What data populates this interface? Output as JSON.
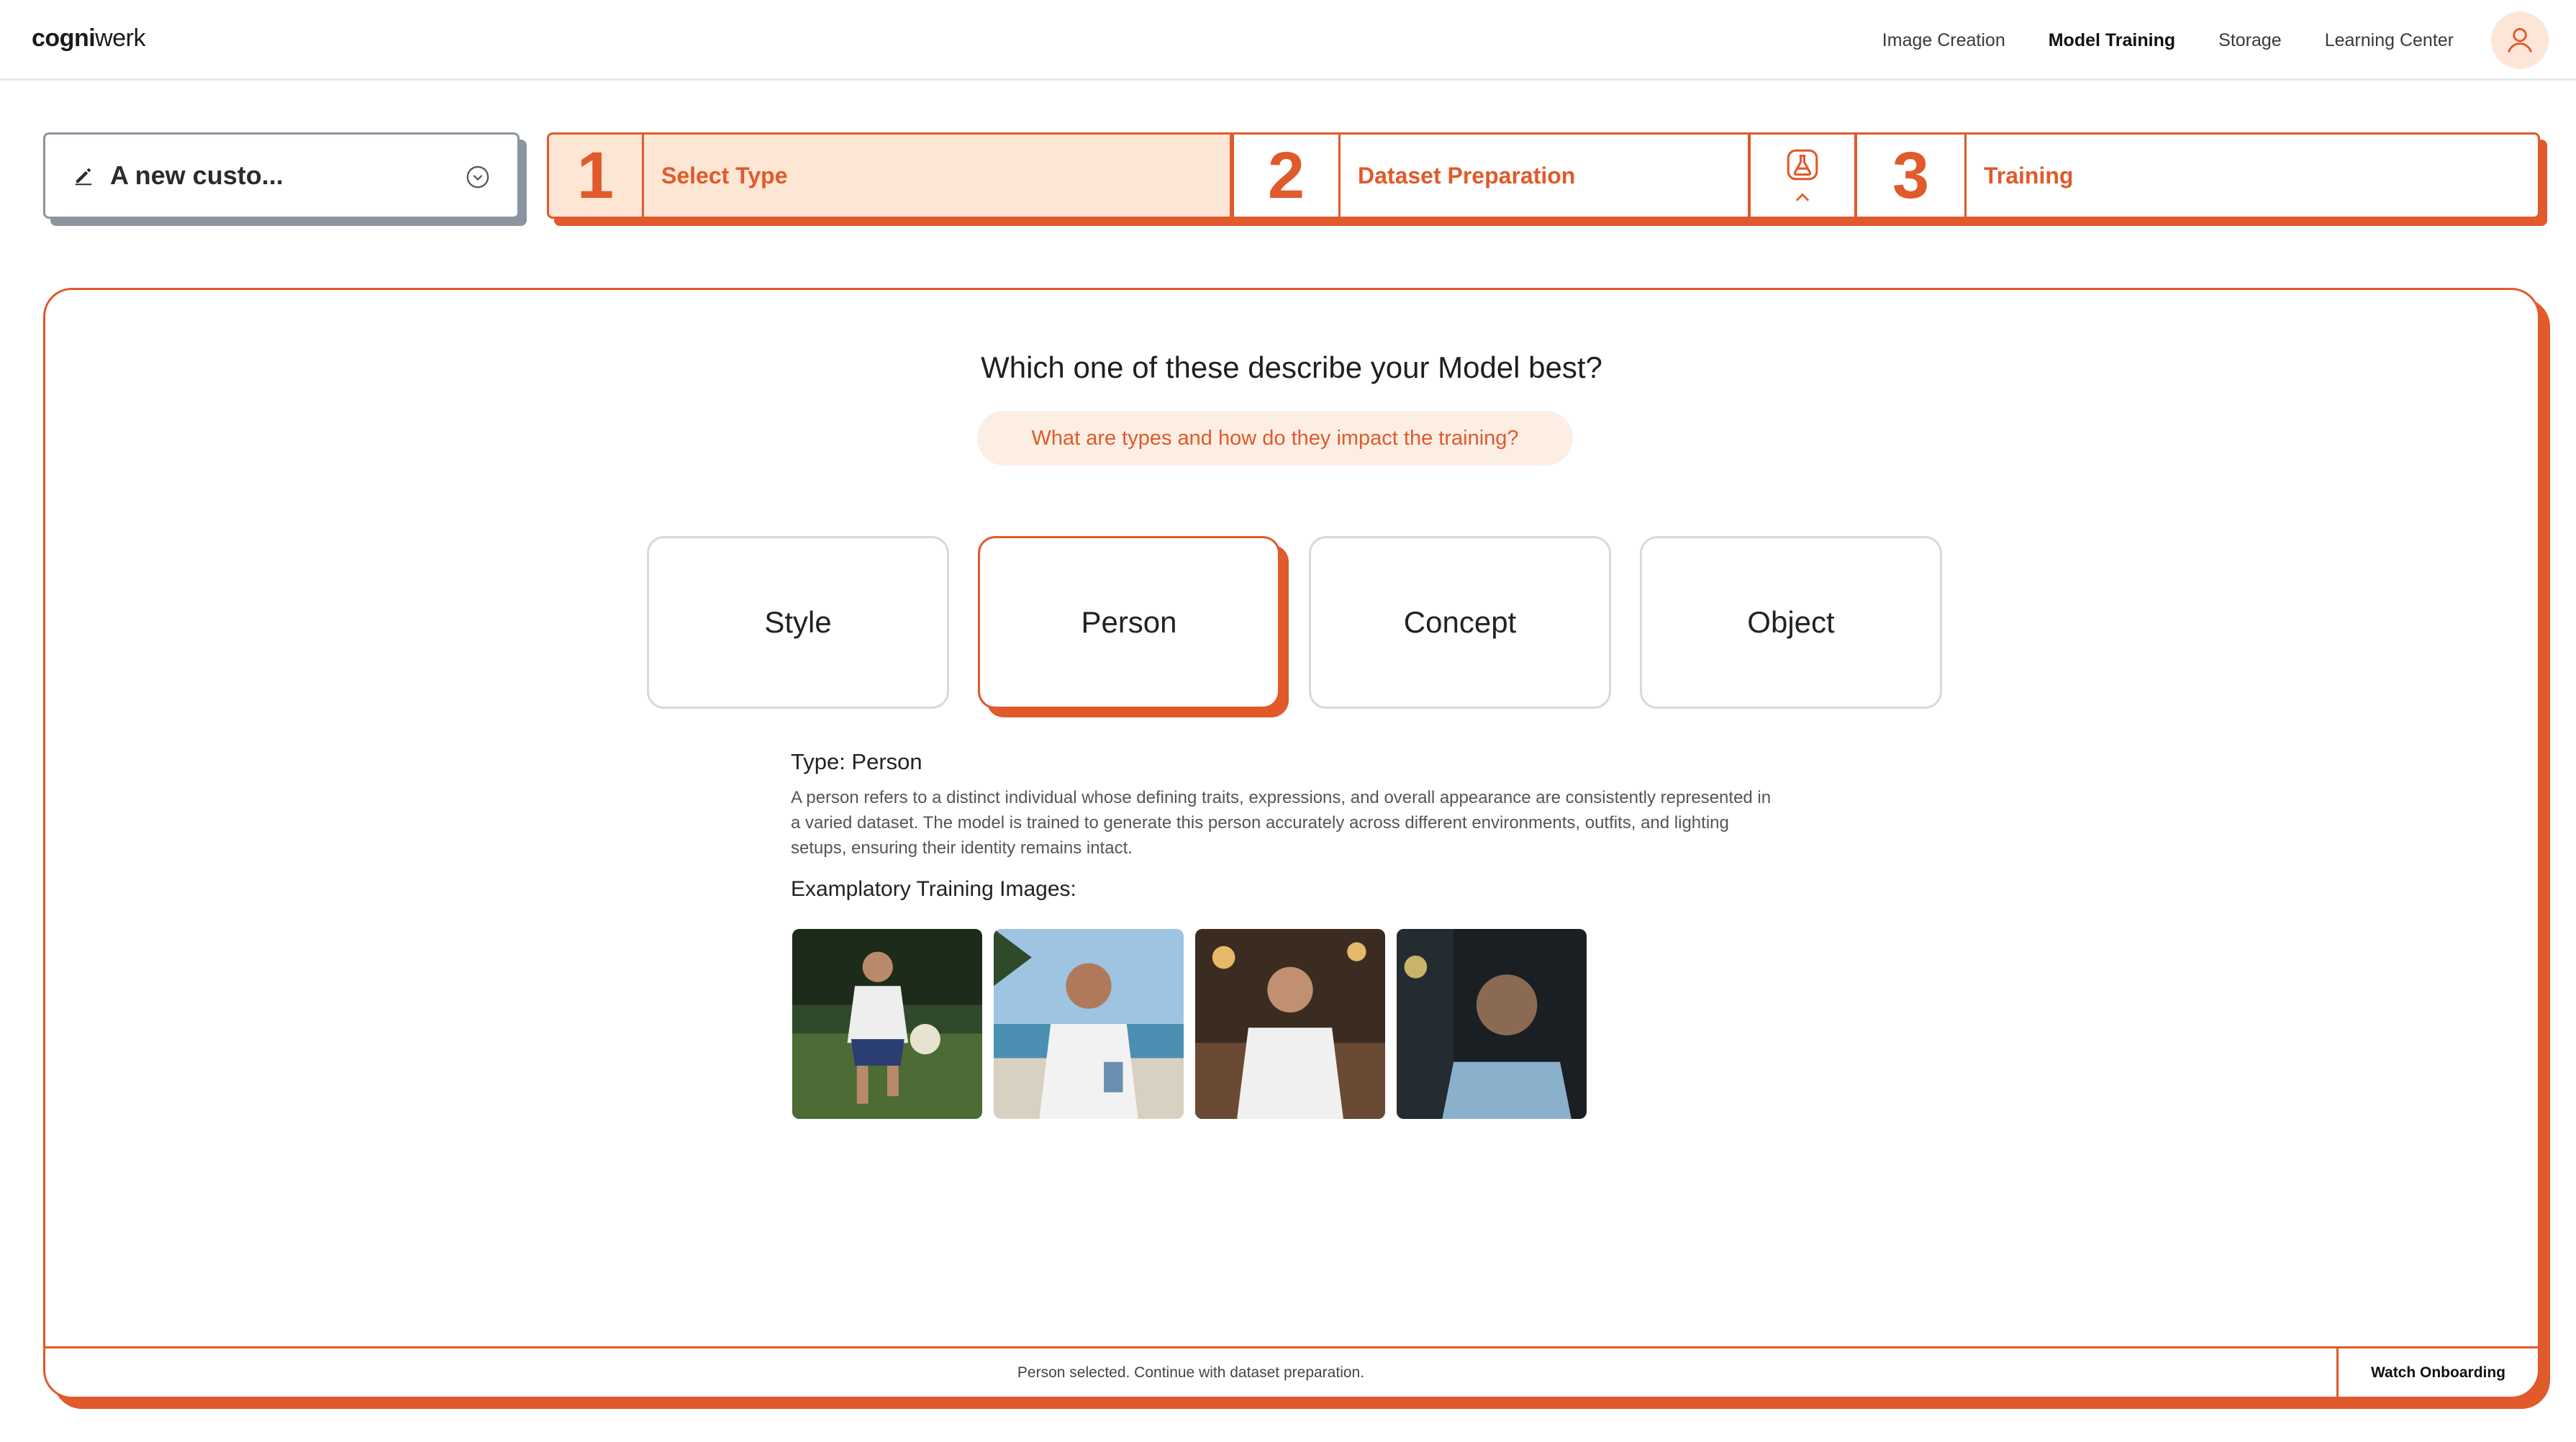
{
  "nav": {
    "logo_bold": "cogni",
    "logo_rest": "werk",
    "links": [
      "Image Creation",
      "Model Training",
      "Storage",
      "Learning Center"
    ],
    "active_link": "Model Training"
  },
  "project": {
    "name": "A new custo..."
  },
  "stepper": {
    "steps": [
      {
        "num": "1",
        "label": "Select Type"
      },
      {
        "num": "2",
        "label": "Dataset Preparation"
      },
      {
        "num": "3",
        "label": "Training"
      }
    ],
    "active_step": 1
  },
  "main": {
    "question": "Which one of these describe your Model best?",
    "help_link": "What are types and how do they impact the training?",
    "types": [
      "Style",
      "Person",
      "Concept",
      "Object"
    ],
    "selected_type": "Person",
    "type_title": "Type: Person",
    "type_description": "A person refers to a distinct individual whose defining traits, expressions, and overall appearance are consistently represented in a varied dataset. The model is trained to generate this person accurately across different environments, outfits, and lighting setups, ensuring their identity remains intact.",
    "examples_label": "Examplatory Training Images:"
  },
  "status": {
    "message": "Person selected. Continue with dataset preparation.",
    "onboarding_button": "Watch Onboarding"
  },
  "colors": {
    "accent": "#e05a2b",
    "accent_light": "#fde6d4",
    "border_gray": "#8a95a0"
  },
  "icons": {
    "edit": "pencil-icon",
    "chevron": "chevron-down-circle-icon",
    "flask": "flask-icon",
    "user": "user-icon"
  }
}
